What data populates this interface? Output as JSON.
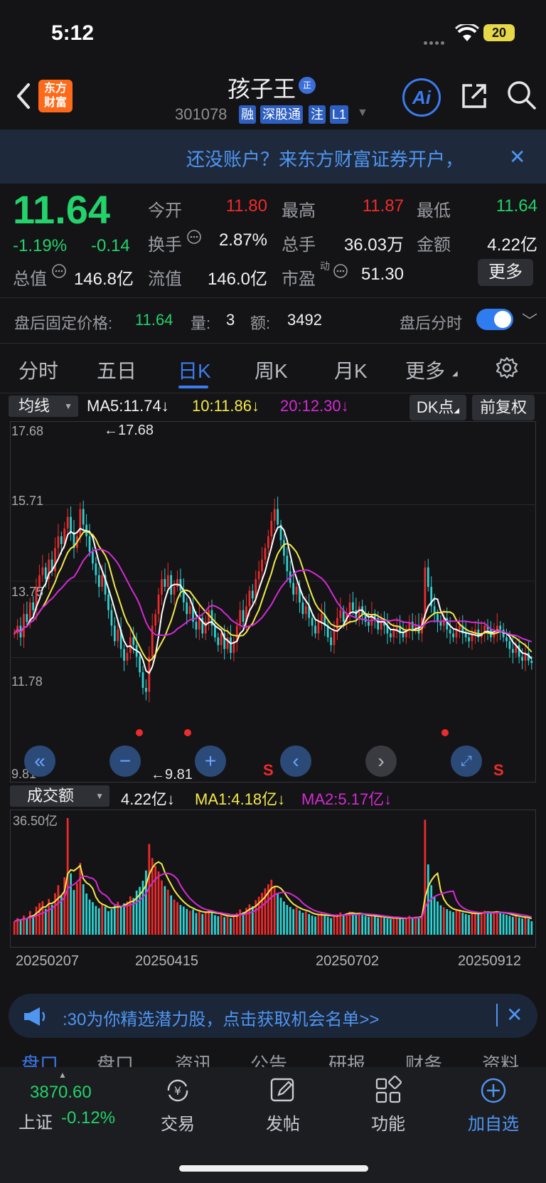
{
  "status": {
    "time": "5:12",
    "battery": "20"
  },
  "header": {
    "logo_line1": "东方",
    "logo_line2": "财富",
    "stock_name": "孩子王",
    "name_badge": "正",
    "stock_code": "301078",
    "tags": [
      "融",
      "深股通",
      "注",
      "L1"
    ],
    "ai_label": "Ai"
  },
  "account_banner": {
    "text": "还没账户？来东方财富证券开户，"
  },
  "quote": {
    "price": "11.64",
    "change_pct": "-1.19%",
    "change_amt": "-0.14",
    "open_label": "今开",
    "open": "11.80",
    "high_label": "最高",
    "high": "11.87",
    "low_label": "最低",
    "low": "11.64",
    "turnover_label": "换手",
    "turnover": "2.87%",
    "volume_label": "总手",
    "volume": "36.03万",
    "amount_label": "金额",
    "amount": "4.22亿",
    "mktcap_label": "总值",
    "mktcap": "146.8亿",
    "float_label": "流值",
    "float": "146.0亿",
    "pe_label": "市盈",
    "pe_sup": "动",
    "pe": "51.30",
    "more_label": "更多"
  },
  "after_hours": {
    "label": "盘后固定价格:",
    "price": "11.64",
    "vol_label": "量:",
    "vol": "3",
    "amt_label": "额:",
    "amt": "3492",
    "intraday_label": "盘后分时",
    "toggle_on": true
  },
  "period_tabs": [
    "分时",
    "五日",
    "日K",
    "周K",
    "月K",
    "更多"
  ],
  "active_tab": "日K",
  "kline_header": {
    "indicator": "均线",
    "ma5": "MA5:11.74↓",
    "ma10": "10:11.86↓",
    "ma20": "20:12.30↓",
    "dk_label": "DK点",
    "adjust_label": "前复权"
  },
  "volume_header": {
    "indicator": "成交额",
    "current": "4.22亿↓",
    "ma1": "MA1:4.18亿↓",
    "ma2": "MA2:5.17亿↓",
    "max_label": "36.50亿"
  },
  "colors": {
    "up": "#ef2b2b",
    "down": "#2ed3d3",
    "ma5": "#ffffff",
    "ma10": "#f2e94a",
    "ma20": "#d42ad4",
    "accent": "#3b7cf0"
  },
  "chart_data": {
    "type": "candlestick",
    "y_axis_labels": [
      "17.68",
      "15.71",
      "13.75",
      "11.78",
      "9.81"
    ],
    "ylim": [
      9.81,
      17.68
    ],
    "high_marker": "←17.68",
    "low_marker": "←9.81",
    "x_tick_labels": [
      "20250207",
      "20250415",
      "20250702",
      "20250912"
    ],
    "signal_label": "S",
    "closes": [
      12.4,
      12.6,
      12.3,
      12.9,
      12.7,
      13.2,
      13.0,
      13.6,
      13.9,
      14.1,
      13.8,
      14.3,
      14.0,
      14.6,
      14.9,
      14.7,
      15.1,
      15.4,
      15.0,
      14.6,
      14.9,
      15.6,
      15.2,
      14.9,
      14.5,
      14.2,
      13.9,
      13.6,
      13.9,
      13.4,
      13.0,
      12.6,
      12.2,
      12.5,
      12.0,
      11.7,
      11.9,
      12.3,
      12.1,
      11.8,
      11.4,
      11.0,
      10.9,
      11.8,
      12.6,
      12.9,
      13.4,
      13.8,
      13.6,
      13.9,
      13.4,
      13.6,
      13.8,
      13.5,
      13.2,
      12.9,
      13.1,
      12.7,
      12.5,
      12.8,
      12.4,
      12.7,
      13.0,
      12.6,
      12.3,
      12.1,
      12.4,
      12.0,
      12.3,
      11.9,
      12.2,
      12.6,
      13.0,
      12.7,
      13.1,
      13.5,
      13.3,
      13.8,
      14.0,
      14.3,
      14.6,
      14.9,
      15.3,
      15.6,
      15.2,
      14.8,
      14.4,
      14.0,
      13.7,
      13.4,
      13.6,
      13.2,
      12.9,
      13.1,
      12.8,
      12.6,
      12.4,
      12.7,
      12.9,
      12.6,
      12.3,
      12.1,
      12.5,
      12.8,
      13.0,
      12.7,
      12.9,
      13.2,
      13.0,
      12.8,
      13.1,
      12.9,
      12.7,
      12.6,
      12.9,
      12.8,
      12.5,
      12.7,
      12.6,
      12.4,
      12.3,
      12.5,
      12.6,
      12.4,
      12.3,
      12.5,
      12.7,
      12.5,
      12.6,
      12.4,
      12.8,
      14.1,
      13.6,
      13.1,
      12.9,
      12.7,
      12.6,
      12.8,
      12.5,
      12.4,
      12.3,
      12.5,
      12.6,
      12.4,
      12.3,
      12.2,
      12.4,
      12.5,
      12.3,
      12.4,
      12.6,
      12.5,
      12.3,
      12.4,
      12.6,
      12.5,
      12.3,
      12.2,
      12.0,
      11.9,
      12.1,
      11.8,
      11.7,
      11.9,
      11.7,
      11.64
    ],
    "amounts": [
      4.1,
      5.2,
      4.6,
      6.0,
      5.1,
      7.4,
      6.2,
      8.8,
      9.9,
      10.5,
      8.1,
      11.2,
      9.4,
      13.0,
      15.5,
      12.3,
      18.0,
      36.5,
      19.2,
      14.0,
      16.1,
      22.5,
      15.8,
      12.9,
      11.0,
      10.2,
      9.0,
      8.3,
      9.5,
      8.8,
      7.4,
      8.0,
      9.1,
      10.3,
      8.9,
      9.8,
      10.4,
      12.0,
      11.5,
      13.8,
      15.0,
      16.9,
      20.1,
      28.4,
      24.0,
      21.5,
      19.8,
      17.0,
      15.2,
      14.1,
      12.3,
      11.0,
      10.2,
      9.3,
      8.8,
      8.1,
      7.5,
      7.9,
      6.8,
      7.2,
      6.5,
      7.0,
      7.8,
      6.9,
      6.1,
      5.8,
      6.4,
      5.5,
      6.0,
      5.2,
      5.9,
      6.8,
      7.9,
      7.1,
      8.4,
      9.5,
      8.9,
      10.8,
      11.9,
      13.1,
      14.5,
      15.8,
      17.2,
      15.0,
      12.9,
      11.6,
      10.4,
      9.3,
      8.7,
      8.0,
      8.5,
      7.6,
      6.9,
      7.3,
      6.5,
      6.0,
      5.7,
      6.2,
      6.8,
      6.1,
      5.6,
      5.2,
      5.9,
      6.4,
      7.0,
      6.3,
      6.7,
      7.2,
      6.8,
      6.1,
      6.6,
      6.2,
      5.9,
      5.6,
      6.1,
      5.8,
      5.3,
      5.7,
      5.4,
      5.1,
      4.9,
      5.3,
      5.5,
      5.0,
      4.8,
      5.2,
      5.9,
      5.4,
      5.6,
      5.1,
      6.3,
      36.0,
      22.0,
      15.5,
      12.0,
      10.4,
      9.2,
      8.6,
      8.0,
      7.5,
      7.1,
      7.8,
      7.4,
      6.9,
      6.5,
      6.2,
      6.8,
      7.1,
      6.6,
      6.9,
      7.5,
      7.2,
      6.7,
      6.9,
      7.4,
      7.0,
      6.5,
      6.2,
      5.9,
      5.6,
      6.0,
      5.4,
      5.1,
      5.5,
      5.0,
      4.22
    ]
  },
  "promo": {
    "text": ":30为你精选潜力股，点击获取机会名单>>"
  },
  "sub_tabs": [
    "盘口",
    "盘口",
    "资讯",
    "公告",
    "研报",
    "财务",
    "资料"
  ],
  "bottom_nav": {
    "index_value": "3870.60",
    "index_name": "上证",
    "index_change": "-0.12%",
    "items": [
      "交易",
      "发帖",
      "功能",
      "加自选"
    ]
  }
}
